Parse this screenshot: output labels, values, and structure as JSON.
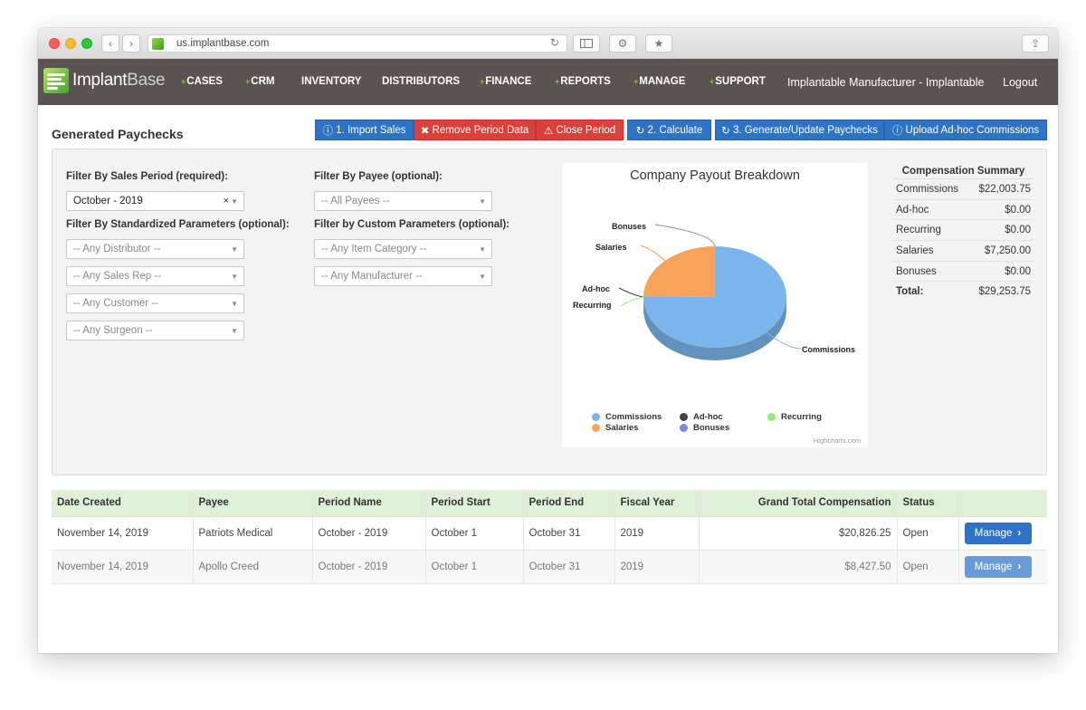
{
  "browser": {
    "url": "us.implantbase.com"
  },
  "brand": {
    "name_a": "Implant",
    "name_b": "Base"
  },
  "nav": {
    "items": [
      "CASES",
      "CRM",
      "INVENTORY",
      "DISTRIBUTORS",
      "FINANCE",
      "REPORTS",
      "MANAGE",
      "SUPPORT"
    ],
    "org": "Implantable Manufacturer - Implantable",
    "logout": "Logout"
  },
  "page": {
    "title": "Generated Paychecks"
  },
  "toolbar": {
    "import": "1. Import Sales",
    "remove": "Remove Period Data",
    "close": "Close Period",
    "calculate": "2. Calculate",
    "generate": "3. Generate/Update Paychecks",
    "adhoc": "Upload Ad-hoc Commissions"
  },
  "filters": {
    "period_label": "Filter By Sales Period (required):",
    "period_value": "October - 2019",
    "payee_label": "Filter By Payee (optional):",
    "payee_placeholder": "-- All Payees --",
    "std_label": "Filter By Standardized Parameters (optional):",
    "custom_label": "Filter by Custom Parameters (optional):",
    "distributor": "-- Any Distributor --",
    "sales_rep": "-- Any Sales Rep --",
    "customer": "-- Any Customer --",
    "surgeon": "-- Any Surgeon --",
    "item_category": "-- Any Item Category --",
    "manufacturer": "-- Any Manufacturer --"
  },
  "chart_data": {
    "type": "pie",
    "title": "Company Payout Breakdown",
    "categories": [
      "Commissions",
      "Ad-hoc",
      "Recurring",
      "Salaries",
      "Bonuses"
    ],
    "values": [
      22003.75,
      0,
      0,
      7250,
      0
    ],
    "colors": [
      "#7cb5ec",
      "#434348",
      "#90ed7d",
      "#f7a35c",
      "#8085e9"
    ],
    "legend": "bottom",
    "credit": "Highcharts.com"
  },
  "summary": {
    "title": "Compensation Summary",
    "rows": [
      {
        "label": "Commissions",
        "value": "$22,003.75"
      },
      {
        "label": "Ad-hoc",
        "value": "$0.00"
      },
      {
        "label": "Recurring",
        "value": "$0.00"
      },
      {
        "label": "Salaries",
        "value": "$7,250.00"
      },
      {
        "label": "Bonuses",
        "value": "$0.00"
      }
    ],
    "total_label": "Total:",
    "total_value": "$29,253.75"
  },
  "table": {
    "headers": [
      "Date Created",
      "Payee",
      "Period Name",
      "Period Start",
      "Period End",
      "Fiscal Year",
      "Grand Total Compensation",
      "Status",
      ""
    ],
    "rows": [
      {
        "date": "November 14, 2019",
        "payee": "Patriots Medical",
        "period": "October - 2019",
        "start": "October 1",
        "end": "October 31",
        "fy": "2019",
        "total": "$20,826.25",
        "status": "Open",
        "action": "Manage"
      },
      {
        "date": "November 14, 2019",
        "payee": "Apollo Creed",
        "period": "October - 2019",
        "start": "October 1",
        "end": "October 31",
        "fy": "2019",
        "total": "$8,427.50",
        "status": "Open",
        "action": "Manage"
      }
    ]
  }
}
